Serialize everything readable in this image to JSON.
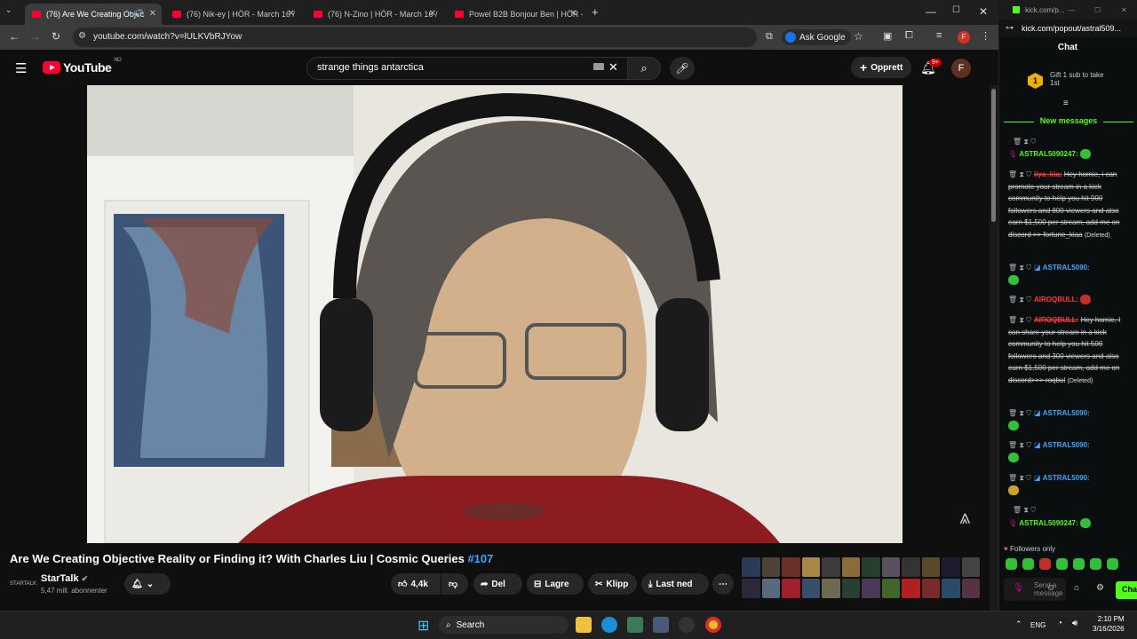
{
  "browser": {
    "tabs": [
      {
        "label": "(76) Are We Creating Objec",
        "active": true
      },
      {
        "label": "(76) Nik-ey | HÖR - March 16 /",
        "active": false
      },
      {
        "label": "(76) N-Zino | HÖR - March 16 /",
        "active": false
      },
      {
        "label": "Powel B2B Bonjour Ben | HÖR -",
        "active": false
      }
    ],
    "url": "youtube.com/watch?v=lULKVbRJYow",
    "ask_google": "Ask Google",
    "profile_initial": "F"
  },
  "youtube": {
    "logo_text": "YouTube",
    "logo_region": "NO",
    "search_value": "strange things antarctica",
    "create_label": "Opprett",
    "notif_count": "9+",
    "avatar_initial": "F"
  },
  "video": {
    "title": "Are We Creating Objective Reality or Finding it? With Charles Liu | Cosmic Queries ",
    "hashtag": "#107",
    "channel_avatar_text": "STARTALK",
    "channel_name": "StarTalk",
    "subscribers": "5,47 mill. abonnenter",
    "likes": "4,4k",
    "share_label": "Del",
    "save_label": "Lagre",
    "clip_label": "Klipp",
    "download_label": "Last ned"
  },
  "kick": {
    "window_title": "kick.com/p...",
    "url": "kick.com/popout/astral509...",
    "chat_label": "Chat",
    "gift_badge": "1",
    "gift_text_line1": "Gift 1 sub to take",
    "gift_text_line2": "1st",
    "new_messages": "New messages",
    "messages": [
      {
        "user": "ASTRAL5090247:",
        "color": "#53fc18",
        "text": "",
        "deleted": false
      },
      {
        "user": "iiya_kia:",
        "color": "#ff3b3b",
        "text": "Hey homie, i can promote your stream in a kick community to help you hit 900 followers and 800 viewers and also earn $1,500 per stream, add me on discord >> fortune_kiaa",
        "deleted": true,
        "deleted_tag": "(Deleted)"
      },
      {
        "user": "ASTRAL5090:",
        "color": "#3ea6ff",
        "text": "",
        "deleted": false
      },
      {
        "user": "AIROQBULL:",
        "color": "#ff3b3b",
        "text": "",
        "deleted": false
      },
      {
        "user": "AIROQBULL:",
        "color": "#ff3b3b",
        "text": "Hey homie, I can share your stream in a kick community to help you hit 500 followers and 300 viewers and also earn $1,500 per stream, add me on discord>>> roqbul",
        "deleted": true,
        "deleted_tag": "(Deleted)"
      },
      {
        "user": "ASTRAL5090:",
        "color": "#3ea6ff",
        "text": "",
        "deleted": false
      },
      {
        "user": "ASTRAL5090:",
        "color": "#3ea6ff",
        "text": "",
        "deleted": false
      },
      {
        "user": "ASTRAL5090:",
        "color": "#3ea6ff",
        "text": "",
        "deleted": false
      },
      {
        "user": "ASTRAL5090247:",
        "color": "#53fc18",
        "text": "",
        "deleted": false
      }
    ],
    "followers_only": "Followers only",
    "send_placeholder": "Send a message",
    "chat_button": "Cha"
  },
  "taskbar": {
    "search_label": "Search",
    "lang": "ENG",
    "time": "2:10 PM",
    "date": "3/16/2026"
  },
  "colors": {
    "kick_green": "#53fc18",
    "yt_red": "#ff0033"
  }
}
